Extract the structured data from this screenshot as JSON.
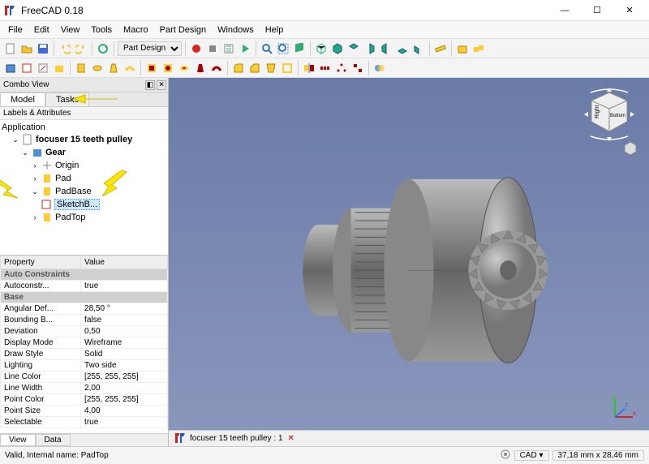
{
  "window": {
    "title": "FreeCAD 0.18",
    "min": "—",
    "max": "☐",
    "close": "✕"
  },
  "menu": {
    "items": [
      "File",
      "Edit",
      "View",
      "Tools",
      "Macro",
      "Part Design",
      "Windows",
      "Help"
    ]
  },
  "workbench": {
    "selected": "Part Design"
  },
  "combo": {
    "panel_title": "Combo View",
    "tabs": {
      "model": "Model",
      "tasks": "Tasks"
    },
    "labels_header": "Labels & Attributes",
    "tree": {
      "root": "Application",
      "doc": "focuser 15 teeth pulley",
      "gear": "Gear",
      "origin": "Origin",
      "pad": "Pad",
      "padbase": "PadBase",
      "sketchbase": "SketchB...",
      "padtop": "PadTop"
    }
  },
  "props": {
    "header_prop": "Property",
    "header_val": "Value",
    "groups": {
      "autoc": "Auto Constraints",
      "base": "Base"
    },
    "rows": [
      {
        "p": "Autoconstr...",
        "v": "true"
      },
      {
        "p": "Angular Def...",
        "v": "28,50 °"
      },
      {
        "p": "Bounding B...",
        "v": "false"
      },
      {
        "p": "Deviation",
        "v": "0,50"
      },
      {
        "p": "Display Mode",
        "v": "Wireframe"
      },
      {
        "p": "Draw Style",
        "v": "Solid"
      },
      {
        "p": "Lighting",
        "v": "Two side"
      },
      {
        "p": "Line Color",
        "v": "[255, 255, 255]"
      },
      {
        "p": "Line Width",
        "v": "2,00"
      },
      {
        "p": "Point Color",
        "v": "[255, 255, 255]"
      },
      {
        "p": "Point Size",
        "v": "4,00"
      },
      {
        "p": "Selectable",
        "v": "true"
      }
    ],
    "tabs": {
      "view": "View",
      "data": "Data"
    }
  },
  "docbar": {
    "doc_name": "focuser 15 teeth pulley : 1",
    "close": "✕"
  },
  "status": {
    "left": "Valid, Internal name: PadTop",
    "cad": "CAD",
    "coords": "37,18 mm x 28,46 mm"
  },
  "navcube": {
    "right": "Right",
    "bottom": "Bottom"
  },
  "icons": {
    "logo_primary": "#cc2222",
    "logo_secondary": "#2255cc"
  }
}
